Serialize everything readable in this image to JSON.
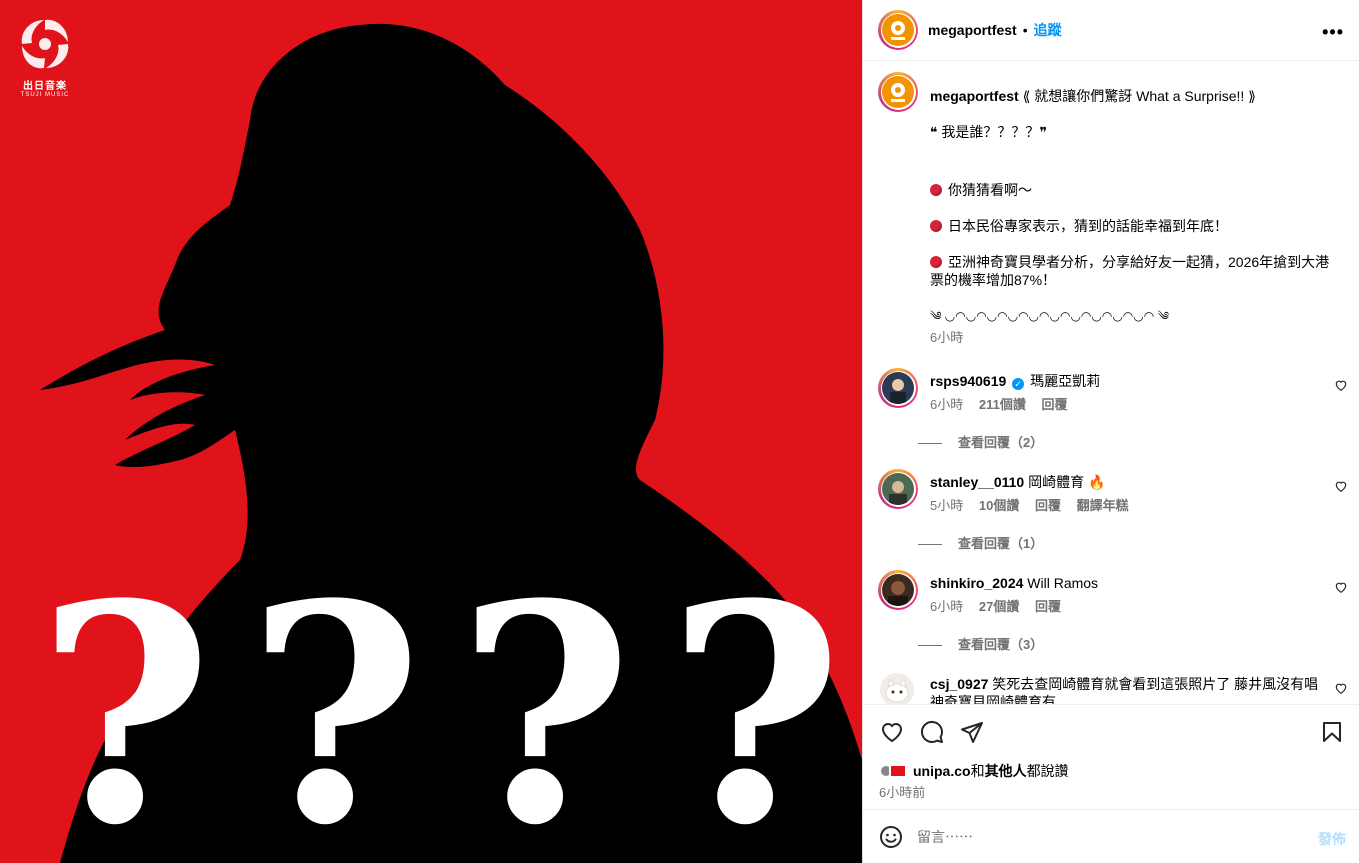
{
  "brand": {
    "name": "出日音楽",
    "sub": "TSUJI MUSIC"
  },
  "media": {
    "question_marks": [
      "?",
      "?",
      "?",
      "?"
    ],
    "background_color": "#e0121a"
  },
  "header": {
    "username": "megaportfest",
    "dot": "•",
    "follow_label": "追蹤",
    "more_icon": "more-horizontal-icon"
  },
  "caption": {
    "username": "megaportfest",
    "lines": [
      " ⟪ 就想讓你們驚訝 What a Surprise!! ⟫",
      "❝ 我是誰？？？？❞",
      "你猜猜看啊～",
      "日本民俗專家表示，猜到的話能幸福到年底！",
      "亞洲神奇寶貝學者分析，分享給好友一起猜，2026年搶到大港",
      "票的機率增加87%！",
      "༄ ◡◠◡◠◡◠◡◠◡◠◡◠◡◠◡◠◡◠◡◠ ༄"
    ],
    "time": "6小時"
  },
  "comments": [
    {
      "username": "rsps940619",
      "verified": true,
      "text": "瑪麗亞凱莉",
      "time": "6小時",
      "likes": "211個讚",
      "reply": "回覆",
      "translate": "",
      "view_replies": "查看回覆（2）"
    },
    {
      "username": "stanley__0110",
      "verified": false,
      "text": "岡崎體育 🔥",
      "time": "5小時",
      "likes": "10個讚",
      "reply": "回覆",
      "translate": "翻譯年糕",
      "view_replies": "查看回覆（1）"
    },
    {
      "username": "shinkiro_2024",
      "verified": false,
      "text": "Will Ramos",
      "time": "6小時",
      "likes": "27個讚",
      "reply": "回覆",
      "translate": "",
      "view_replies": "查看回覆（3）"
    },
    {
      "username": "csj_0927",
      "verified": false,
      "text": "笑死去查岡崎體育就會看到這張照片了 藤井風沒有唱神奇寶貝岡崎體育有",
      "time": "",
      "likes": "",
      "reply": "",
      "translate": "",
      "view_replies": ""
    }
  ],
  "actions": {
    "like_icon": "heart-icon",
    "comment_icon": "comment-icon",
    "share_icon": "send-icon",
    "save_icon": "bookmark-icon"
  },
  "likes": {
    "user": "unipa.co",
    "and": "和",
    "others": "其他人",
    "suffix": "都說讚"
  },
  "posted": "6小時前",
  "comment_input": {
    "placeholder": "留言⋯⋯",
    "post_label": "發佈",
    "emoji_icon": "emoji-icon"
  }
}
